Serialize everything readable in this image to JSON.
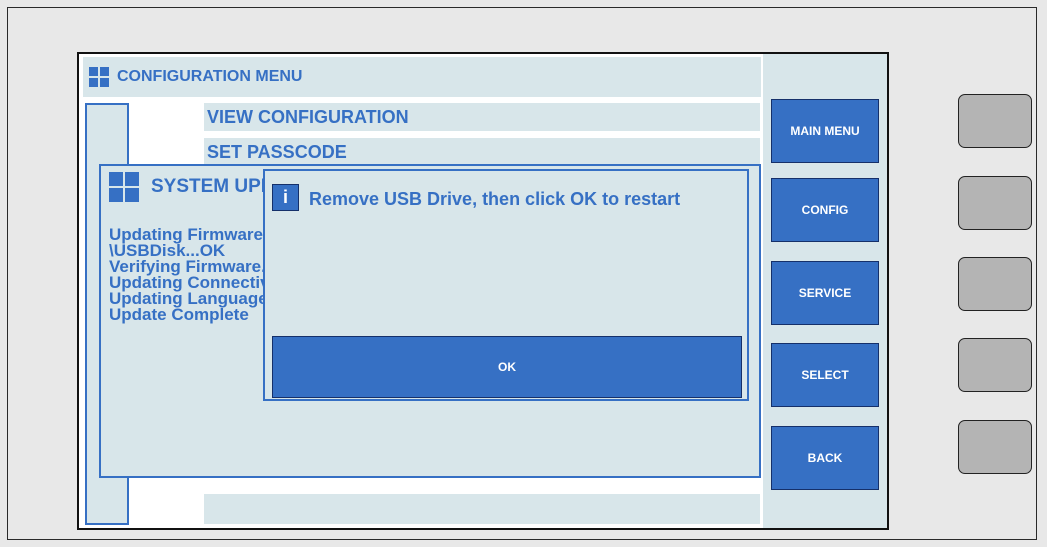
{
  "config_menu": {
    "title": "CONFIGURATION MENU",
    "items": [
      "VIEW CONFIGURATION",
      "SET PASSCODE"
    ]
  },
  "system_update_dialog": {
    "title": "SYSTEM UPDATE",
    "log": "Updating Firmware from\n\\USBDisk...OK\nVerifying Firmware...OK\nUpdating Connectivity...OK\nUpdating Languages...OK\nUpdate Complete"
  },
  "message_dialog": {
    "icon": "info-icon",
    "message": "Remove USB Drive, then click OK to restart",
    "ok_label": "OK"
  },
  "side_menu": {
    "main_menu": "MAIN MENU",
    "config": "CONFIG",
    "service": "SERVICE",
    "select": "SELECT",
    "back": "BACK"
  },
  "colors": {
    "accent": "#3670c4",
    "panel": "#d8e6ea",
    "hardware_button": "#b4b4b4"
  }
}
